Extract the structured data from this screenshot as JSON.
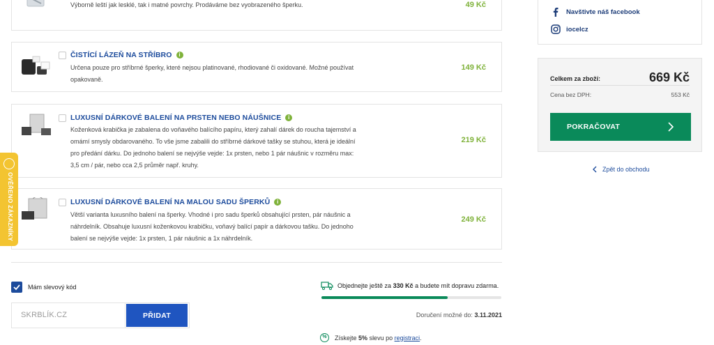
{
  "items": [
    {
      "title": "",
      "description": "Výborně leští jak lesklé, tak i matné povrchy. Prodáváme bez vyobrazeného šperku.",
      "price": "49 Kč"
    },
    {
      "title": "ČISTÍCÍ LÁZEŇ NA STŘÍBRO",
      "description": "Určena pouze pro stříbrné šperky, které nejsou platinované, rhodiované či oxidované. Možné používat opakovaně.",
      "price": "149 Kč"
    },
    {
      "title": "LUXUSNÍ DÁRKOVÉ BALENÍ NA PRSTEN NEBO NÁUŠNICE",
      "description": "Koženková krabička je zabalena do voňavého balícího papíru, který zahalí dárek do roucha tajemství a omámí smysly obdarovaného. To vše jsme zabalili do stříbrné dárkové tašky se stuhou, která je ideální pro předání dárku. Do jednoho balení se nejvýše vejde: 1x prsten, nebo 1 pár náušnic v rozměru max: 3,5 cm / pár, nebo cca 2,5 průměr např. kruhy.",
      "price": "219 Kč"
    },
    {
      "title": "LUXUSNÍ DÁRKOVÉ BALENÍ NA MALOU SADU ŠPERKŮ",
      "description": "Větší varianta luxusního balení na šperky. Vhodné i pro sadu šperků obsahující prsten, pár náušnic a náhrdelník. Obsahuje luxusní koženkovou krabičku, voňavý balící papír a dárkovou tašku. Do jednoho balení se nejvýše vejde: 1x prsten, 1 pár náušnic a 1x náhrdelník.",
      "price": "249 Kč"
    }
  ],
  "social": {
    "facebook": "Navštivte náš facebook",
    "instagram": "iocelcz"
  },
  "summary": {
    "total_label": "Celkem za zboží:",
    "total_value": "669 Kč",
    "vat_label": "Cena bez DPH:",
    "vat_value": "553 Kč",
    "continue_label": "POKRAČOVAT"
  },
  "back_link": "Zpět do obchodu",
  "badge": "OVĚŘENO ZÁKAZNÍKY",
  "discount": {
    "checkbox_label": "Mám slevový kód",
    "input_value": "SKRBLÍK.CZ",
    "button_label": "PŘIDAT"
  },
  "shipping": {
    "prefix": "Objednejte ještě za",
    "amount": "330 Kč",
    "suffix": "a budete mít dopravu zdarma.",
    "progress": 0.7
  },
  "delivery": {
    "label": "Doručení možné do:",
    "date": "3.11.2021"
  },
  "registration": {
    "prefix": "Získejte",
    "percent": "5%",
    "middle": "slevu po",
    "link": "registraci",
    "suffix": "."
  },
  "colors": {
    "accent_green": "#0a8a5a",
    "price_green": "#7fb23a",
    "title_blue": "#1c4b9c",
    "badge_yellow": "#f3c431"
  }
}
